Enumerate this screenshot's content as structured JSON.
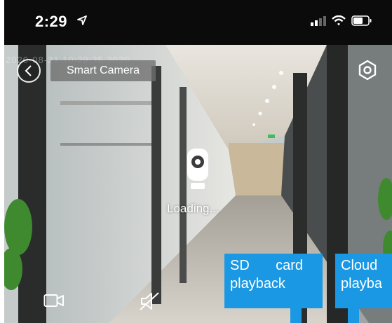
{
  "status_bar": {
    "time": "2:29"
  },
  "header": {
    "title": "Smart Camera",
    "timestamp": "2020-08-31 10:29:35 2020"
  },
  "player": {
    "loading_text": "Loading..."
  },
  "tooltips": {
    "sd_word1": "SD",
    "sd_word2": "card",
    "sd_line2": "playback",
    "cloud_line1": "Cloud",
    "cloud_line2": "playba"
  },
  "colors": {
    "tooltip_blue": "#1a98e3",
    "status_bar_bg": "#0b0b0b"
  },
  "icons": [
    "location-arrow-icon",
    "signal-icon",
    "wifi-icon",
    "battery-icon",
    "back-chevron-icon",
    "settings-icon",
    "camera-placeholder-icon",
    "video-record-icon",
    "speaker-mute-icon"
  ]
}
